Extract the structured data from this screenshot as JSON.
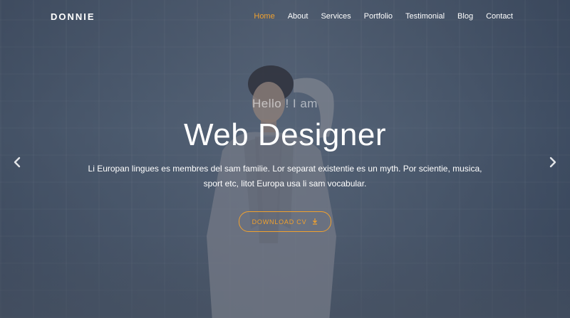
{
  "brand": {
    "name": "DONNIE"
  },
  "nav": {
    "items": [
      {
        "label": "Home",
        "active": true
      },
      {
        "label": "About"
      },
      {
        "label": "Services"
      },
      {
        "label": "Portfolio"
      },
      {
        "label": "Testimonial"
      },
      {
        "label": "Blog"
      },
      {
        "label": "Contact"
      }
    ]
  },
  "hero": {
    "pre_title": "Hello ! I am",
    "title": "Web Designer",
    "description": "Li Europan lingues es membres del sam familie. Lor separat existentie es un myth. Por scientie, musica, sport etc, litot Europa usa li sam vocabular.",
    "button_label": "DOWNLOAD CV",
    "button_icon": "download-icon"
  },
  "slider": {
    "prev_icon": "chevron-left-icon",
    "next_icon": "chevron-right-icon"
  },
  "colors": {
    "accent": "#f0a12f",
    "text": "#ffffff",
    "overlay": "#1e2637"
  }
}
